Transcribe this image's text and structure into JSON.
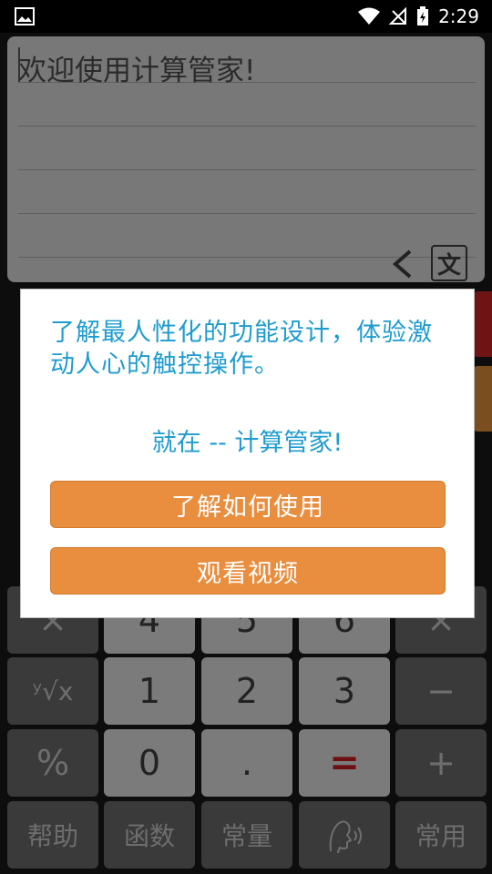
{
  "status_bar": {
    "time": "2:29"
  },
  "display": {
    "text": "欢迎使用计算管家!",
    "lang_label": "文"
  },
  "keypad": {
    "row4": [
      "×",
      "4",
      "5",
      "6",
      "×"
    ],
    "row5": [
      "ʸ√x",
      "1",
      "2",
      "3",
      "−"
    ],
    "row6": [
      "%",
      "0",
      ".",
      "=",
      "+"
    ],
    "bottom": [
      "帮助",
      "函数",
      "常量",
      "",
      "常用"
    ]
  },
  "dialog": {
    "message": "了解最人性化的功能设计，体验激动人心的触控操作。",
    "tagline": "就在 -- 计算管家!",
    "learn_button": "了解如何使用",
    "video_button": "观看视频"
  },
  "colors": {
    "dialog_text": "#1e9ccf",
    "button": "#e98d3e"
  }
}
